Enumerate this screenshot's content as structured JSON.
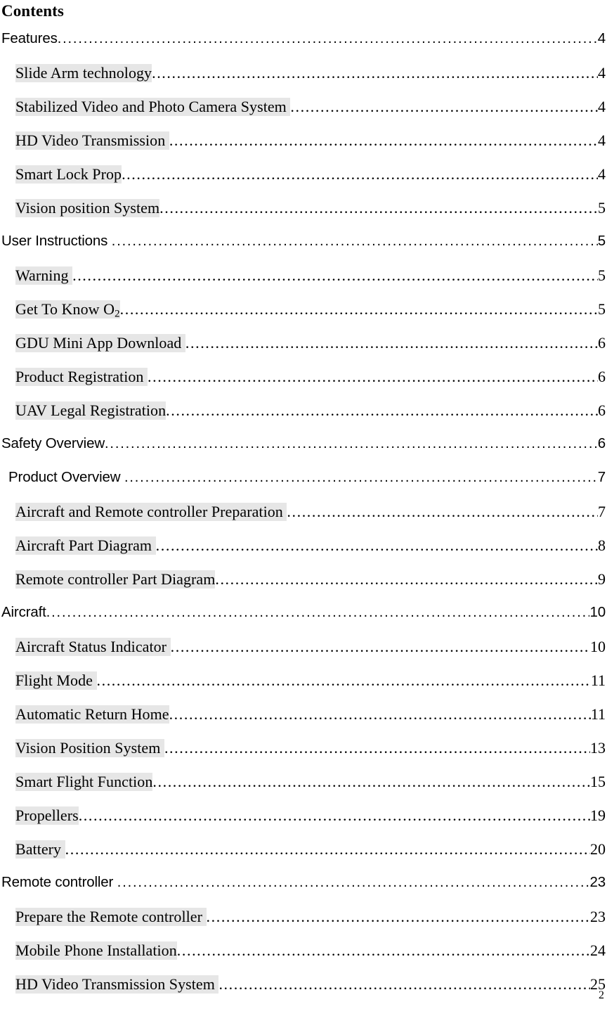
{
  "document": {
    "heading": "Contents",
    "footer_page_number": "2",
    "highlight_color": "#e6e6e6",
    "text_color": "#000000",
    "background_color": "#ffffff"
  },
  "toc": {
    "entries": [
      {
        "label": "Features",
        "page": "4",
        "level": 1,
        "highlight": false,
        "trailing_space": false,
        "indent": false
      },
      {
        "label": "Slide Arm technology",
        "page": "4",
        "level": 2,
        "highlight": true,
        "trailing_space": false,
        "indent": false
      },
      {
        "label": "Stabilized Video and Photo Camera System",
        "page": "4",
        "level": 2,
        "highlight": true,
        "trailing_space": true,
        "indent": false
      },
      {
        "label": "HD Video Transmission",
        "page": "4",
        "level": 2,
        "highlight": true,
        "trailing_space": true,
        "indent": false
      },
      {
        "label": "Smart Lock Prop",
        "page": "4",
        "level": 2,
        "highlight": true,
        "trailing_space": false,
        "indent": false
      },
      {
        "label": "Vision position System",
        "page": "5",
        "level": 2,
        "highlight": true,
        "trailing_space": false,
        "indent": false
      },
      {
        "label": "User Instructions",
        "page": "5",
        "level": 1,
        "highlight": false,
        "trailing_space": true,
        "indent": false
      },
      {
        "label": "Warning",
        "page": "5",
        "level": 2,
        "highlight": true,
        "trailing_space": true,
        "indent": false
      },
      {
        "label": "Get To Know O2",
        "label_base": "Get To Know O",
        "label_sub": "2",
        "page": "5",
        "level": 2,
        "highlight": true,
        "trailing_space": false,
        "indent": false
      },
      {
        "label": "GDU Mini App Download",
        "page": "6",
        "level": 2,
        "highlight": true,
        "trailing_space": true,
        "indent": false
      },
      {
        "label": "Product Registration",
        "page": "6",
        "level": 2,
        "highlight": true,
        "trailing_space": true,
        "indent": false
      },
      {
        "label": "UAV Legal Registration",
        "page": "6",
        "level": 2,
        "highlight": true,
        "trailing_space": false,
        "indent": false
      },
      {
        "label": "Safety Overview",
        "page": "6",
        "level": 1,
        "highlight": false,
        "trailing_space": false,
        "indent": false
      },
      {
        "label": "Product Overview",
        "page": "7",
        "level": 1,
        "highlight": false,
        "trailing_space": true,
        "indent": true
      },
      {
        "label": "Aircraft and Remote controller Preparation",
        "page": "7",
        "level": 2,
        "highlight": true,
        "trailing_space": true,
        "indent": false
      },
      {
        "label": "Aircraft Part Diagram",
        "page": "8",
        "level": 2,
        "highlight": true,
        "trailing_space": true,
        "indent": false
      },
      {
        "label": "Remote controller Part Diagram",
        "page": "9",
        "level": 2,
        "highlight": true,
        "trailing_space": false,
        "indent": false
      },
      {
        "label": "Aircraft",
        "page": "10",
        "level": 1,
        "highlight": false,
        "trailing_space": false,
        "indent": false
      },
      {
        "label": "Aircraft Status Indicator",
        "page": "10",
        "level": 2,
        "highlight": true,
        "trailing_space": true,
        "indent": false
      },
      {
        "label": "Flight Mode",
        "page": "11",
        "level": 2,
        "highlight": true,
        "trailing_space": true,
        "indent": false
      },
      {
        "label": "Automatic Return Home",
        "page": "11",
        "level": 2,
        "highlight": true,
        "trailing_space": false,
        "indent": false
      },
      {
        "label": "Vision Position System",
        "page": "13",
        "level": 2,
        "highlight": true,
        "trailing_space": true,
        "indent": false
      },
      {
        "label": "Smart Flight Function",
        "page": "15",
        "level": 2,
        "highlight": true,
        "trailing_space": false,
        "indent": false
      },
      {
        "label": "Propellers",
        "page": "19",
        "level": 2,
        "highlight": true,
        "trailing_space": false,
        "indent": false
      },
      {
        "label": "Battery",
        "page": "20",
        "level": 2,
        "highlight": true,
        "trailing_space": true,
        "indent": false
      },
      {
        "label": "Remote controller",
        "page": "23",
        "level": 1,
        "highlight": false,
        "trailing_space": true,
        "indent": false
      },
      {
        "label": "Prepare the Remote controller",
        "page": "23",
        "level": 2,
        "highlight": true,
        "trailing_space": true,
        "indent": false
      },
      {
        "label": "Mobile Phone Installation",
        "page": "24",
        "level": 2,
        "highlight": true,
        "trailing_space": false,
        "indent": false
      },
      {
        "label": "HD Video Transmission System",
        "page": "25",
        "level": 2,
        "highlight": true,
        "trailing_space": true,
        "indent": false
      }
    ]
  }
}
